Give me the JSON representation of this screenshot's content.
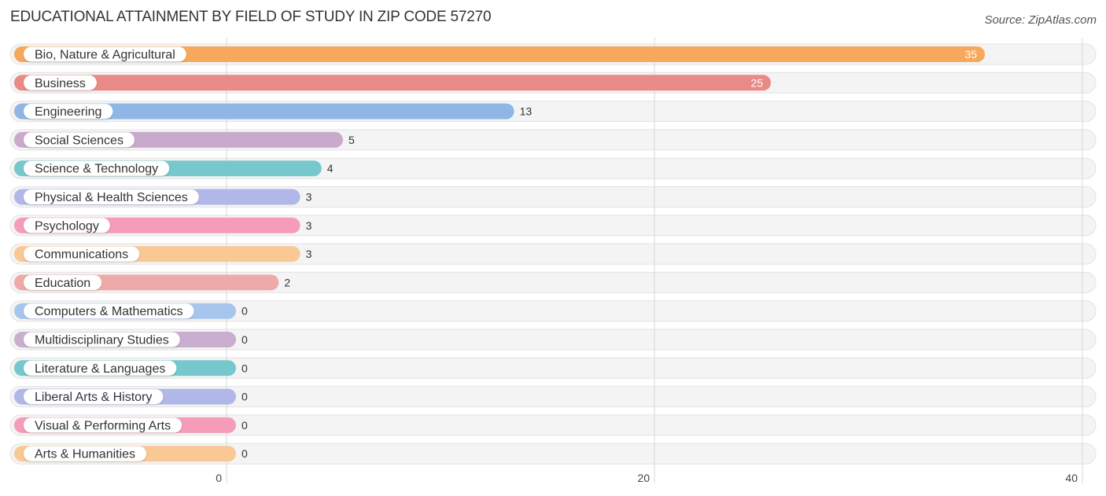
{
  "header": {
    "title": "EDUCATIONAL ATTAINMENT BY FIELD OF STUDY IN ZIP CODE 57270",
    "source": "Source: ZipAtlas.com"
  },
  "chart_data": {
    "type": "bar",
    "orientation": "horizontal",
    "title": "EDUCATIONAL ATTAINMENT BY FIELD OF STUDY IN ZIP CODE 57270",
    "xlabel": "",
    "ylabel": "",
    "xlim": [
      0,
      40
    ],
    "x_ticks": [
      0,
      20,
      40
    ],
    "grid": true,
    "categories": [
      "Bio, Nature & Agricultural",
      "Business",
      "Engineering",
      "Social Sciences",
      "Science & Technology",
      "Physical & Health Sciences",
      "Psychology",
      "Communications",
      "Education",
      "Computers & Mathematics",
      "Multidisciplinary Studies",
      "Literature & Languages",
      "Liberal Arts & History",
      "Visual & Performing Arts",
      "Arts & Humanities"
    ],
    "values": [
      35,
      25,
      13,
      5,
      4,
      3,
      3,
      3,
      2,
      0,
      0,
      0,
      0,
      0,
      0
    ],
    "colors": [
      "#f6a85c",
      "#e88a86",
      "#8fb6e4",
      "#c9a9cc",
      "#76c8cc",
      "#b1b7e8",
      "#f59db8",
      "#f9c895",
      "#eeaaa8",
      "#a7c6ec",
      "#c9aed0",
      "#76c8cc",
      "#b1b7e8",
      "#f59db8",
      "#f9c895"
    ]
  }
}
